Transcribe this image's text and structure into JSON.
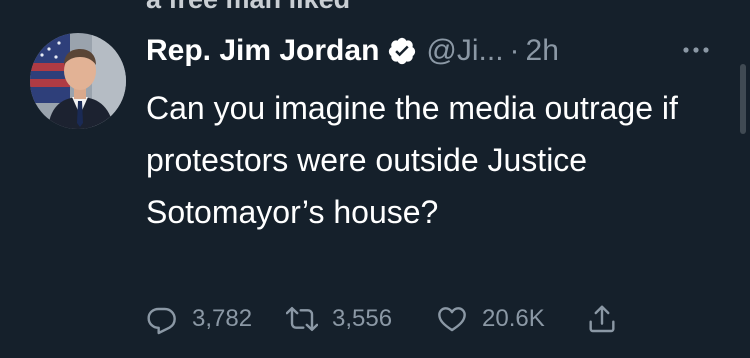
{
  "context": {
    "text": "a free man liked"
  },
  "tweet": {
    "author_name": "Rep. Jim Jordan",
    "verified_icon": "verified-badge-icon",
    "handle": "@Ji...",
    "separator": "·",
    "time": "2h",
    "more_icon": "more-dots-icon",
    "text": "Can you imagine the media outrage if protestors were outside Justice Sotomayor’s house?"
  },
  "actions": {
    "reply": {
      "icon": "reply-bubble-icon",
      "count": "3,782"
    },
    "retweet": {
      "icon": "retweet-icon",
      "count": "3,556"
    },
    "like": {
      "icon": "heart-icon",
      "count": "20.6K"
    },
    "share": {
      "icon": "share-icon"
    }
  },
  "colors": {
    "background": "#15202b",
    "primary_text": "#ffffff",
    "secondary_text": "#8b98a5"
  }
}
